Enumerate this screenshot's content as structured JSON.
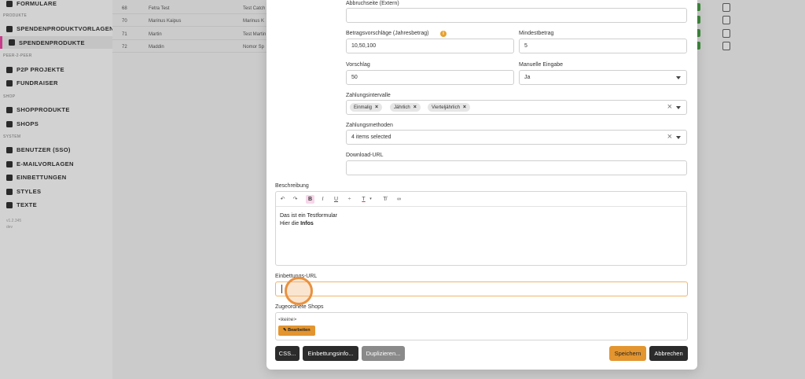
{
  "sidebar": {
    "items": [
      {
        "label": "FORMULARE",
        "icon": "list-icon"
      },
      {
        "label": "SPENDENPRODUKTVORLAGEN",
        "icon": "document-icon"
      },
      {
        "label": "SPENDENPRODUKTE",
        "icon": "box-icon"
      },
      {
        "label": "P2P PROJEKTE",
        "icon": "users-icon"
      },
      {
        "label": "FUNDRAISER",
        "icon": "group-icon"
      },
      {
        "label": "SHOPPRODUKTE",
        "icon": "cart-icon"
      },
      {
        "label": "SHOPS",
        "icon": "store-icon"
      },
      {
        "label": "BENUTZER (SSO)",
        "icon": "user-icon"
      },
      {
        "label": "E-MAILVORLAGEN",
        "icon": "mail-icon"
      },
      {
        "label": "EINBETTUNGEN",
        "icon": "share-icon"
      },
      {
        "label": "STYLES",
        "icon": "brush-icon"
      },
      {
        "label": "TEXTE",
        "icon": "text-icon"
      }
    ],
    "sections": {
      "produkte": "PRODUKTE",
      "p2p": "PEER-2-PEER",
      "shop": "SHOP",
      "system": "SYSTEM"
    },
    "version": "v1.2.345",
    "version_sub": "dev"
  },
  "bg_table": {
    "rows": [
      {
        "id": "68",
        "name": "Fetra Test",
        "desc": "Test Catch"
      },
      {
        "id": "70",
        "name": "Marinus Kaipus",
        "desc": "Marinus K"
      },
      {
        "id": "71",
        "name": "Martin",
        "desc": "Test Martin"
      },
      {
        "id": "72",
        "name": "Maddin",
        "desc": "Nomor Sp"
      }
    ]
  },
  "modal": {
    "abbruch_label": "Abbruchseite (Extern)",
    "abbruch_value": "",
    "betrag_label": "Betragsvorschläge (Jahresbetrag)",
    "betrag_value": "10,50,100",
    "mindest_label": "Mindestbetrag",
    "mindest_value": "5",
    "vorschlag_label": "Vorschlag",
    "vorschlag_value": "50",
    "manuell_label": "Manuelle Eingabe",
    "manuell_value": "Ja",
    "intervalle_label": "Zahlungsintervalle",
    "intervalle": [
      "Einmalig",
      "Jährlich",
      "Vierteljährlich"
    ],
    "methoden_label": "Zahlungsmethoden",
    "methoden_value": "4 items selected",
    "download_label": "Download-URL",
    "download_value": "",
    "beschreibung_label": "Beschreibung",
    "beschreibung_line1": "Das ist ein Testformular",
    "beschreibung_line2_prefix": "Hier die ",
    "beschreibung_line2_bold": "Infos",
    "einbettung_label": "Einbettungs-URL",
    "einbettung_value": "",
    "shops_label": "Zugeordnete Shops",
    "shops_none": "<keine>",
    "shops_edit": "Bearbeiten",
    "btn_css": "CSS...",
    "btn_info": "Einbettungsinfo...",
    "btn_dup": "Duplizieren...",
    "btn_save": "Speichern",
    "btn_cancel": "Abbrechen"
  },
  "colors": {
    "accent_orange": "#e3952f",
    "focus_orange": "#f0b46a",
    "active_sidebar": "#c83a8a"
  }
}
